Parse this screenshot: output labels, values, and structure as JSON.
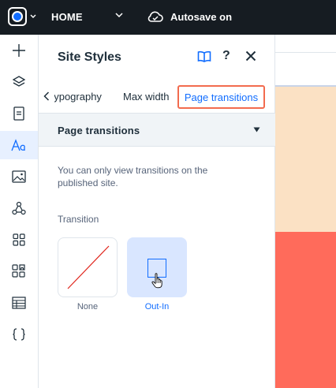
{
  "topbar": {
    "page_name": "HOME",
    "autosave_label": "Autosave on",
    "icons": [
      "site-logo-icon",
      "chevron-down-icon",
      "cloud-check-icon"
    ]
  },
  "leftrail": {
    "items": [
      "add",
      "layers",
      "pages",
      "site-styles",
      "media",
      "connections",
      "apps",
      "business-apps",
      "tables",
      "code"
    ],
    "active": "site-styles"
  },
  "panel": {
    "title": "Site Styles",
    "help_q": "?",
    "tabs": {
      "typography": "Typography",
      "max_width": "Max width",
      "page_transitions": "Page transitions"
    },
    "section_title": "Page transitions",
    "info_text": "You can only view transitions on the published site.",
    "transition_label": "Transition",
    "options": {
      "none": "None",
      "out_in": "Out-In"
    },
    "selected": "Out-In"
  },
  "colors": {
    "accent": "#116dff",
    "highlight_border": "#f26b4e",
    "topbar": "#161c22",
    "canvas_peach": "#fbe1c4",
    "canvas_red": "#ff6b5b"
  }
}
